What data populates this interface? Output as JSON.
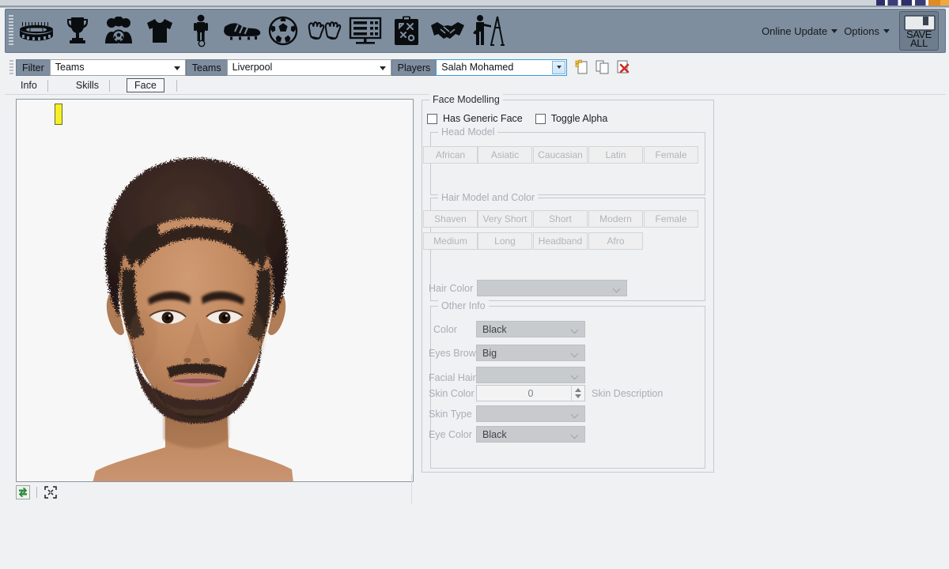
{
  "toolbar": {
    "icons": [
      {
        "name": "stadium-icon",
        "title": "Stadiums"
      },
      {
        "name": "trophy-icon",
        "title": "Competitions"
      },
      {
        "name": "supporters-icon",
        "title": "Teams"
      },
      {
        "name": "jersey-icon",
        "title": "Kits"
      },
      {
        "name": "player-icon",
        "title": "Players"
      },
      {
        "name": "boot-icon",
        "title": "Boots"
      },
      {
        "name": "ball-icon",
        "title": "Balls"
      },
      {
        "name": "gloves-icon",
        "title": "Gloves"
      },
      {
        "name": "scoreboard-icon",
        "title": "Scoreboard"
      },
      {
        "name": "tactics-board-icon",
        "title": "Tactics"
      },
      {
        "name": "handshake-icon",
        "title": "Transfers"
      },
      {
        "name": "coach-easel-icon",
        "title": "Coaches"
      }
    ],
    "online_update_label": "Online Update",
    "options_label": "Options",
    "save_all_line1": "SAVE",
    "save_all_line2": "ALL"
  },
  "filter_bar": {
    "filter_label": "Filter",
    "filter_value": "Teams",
    "teams_label": "Teams",
    "teams_value": "Liverpool",
    "players_label": "Players",
    "players_value": "Salah Mohamed",
    "icons": [
      {
        "name": "new-player-icon"
      },
      {
        "name": "duplicate-player-icon"
      },
      {
        "name": "delete-player-icon"
      }
    ]
  },
  "tabs": [
    {
      "label": "Info",
      "active": false
    },
    {
      "label": "Skills",
      "active": false
    },
    {
      "label": "Face",
      "active": true
    }
  ],
  "preview": {
    "tools": [
      {
        "name": "refresh-model-icon"
      },
      {
        "name": "fullscreen-icon"
      }
    ]
  },
  "face_modelling": {
    "legend": "Face Modelling",
    "checkboxes": [
      {
        "label": "Has Generic Face",
        "checked": false
      },
      {
        "label": "Toggle Alpha",
        "checked": false
      }
    ],
    "head_model": {
      "legend": "Head Model",
      "buttons": [
        "African",
        "Asiatic",
        "Caucasian",
        "Latin",
        "Female"
      ]
    },
    "hair_model": {
      "legend": "Hair Model and Color",
      "buttons_row1": [
        "Shaven",
        "Very Short",
        "Short",
        "Modern",
        "Female"
      ],
      "buttons_row2": [
        "Medium",
        "Long",
        "Headband",
        "Afro"
      ],
      "hair_color_label": "Hair Color",
      "hair_color_value": ""
    },
    "other_info": {
      "legend": "Other Info",
      "fields": [
        {
          "label": "Color",
          "value": "Black",
          "type": "combo"
        },
        {
          "label": "Eyes Brow",
          "value": "Big",
          "type": "combo"
        },
        {
          "label": "Facial Hair",
          "value": "",
          "type": "combo"
        },
        {
          "label": "Skin Color",
          "value": "0",
          "type": "spinner"
        },
        {
          "label": "Skin Type",
          "value": "",
          "type": "combo"
        },
        {
          "label": "Eye Color",
          "value": "Black",
          "type": "combo"
        }
      ],
      "skin_description_label": "Skin Description"
    }
  },
  "colors": {
    "toolbar_bg": "#7e8e9f",
    "window_bg": "#eff1f3",
    "accent_focus": "#3f9ad9",
    "marker_yellow": "#f5ef2a",
    "skin": "#c08a62",
    "hair": "#3b2a22"
  }
}
